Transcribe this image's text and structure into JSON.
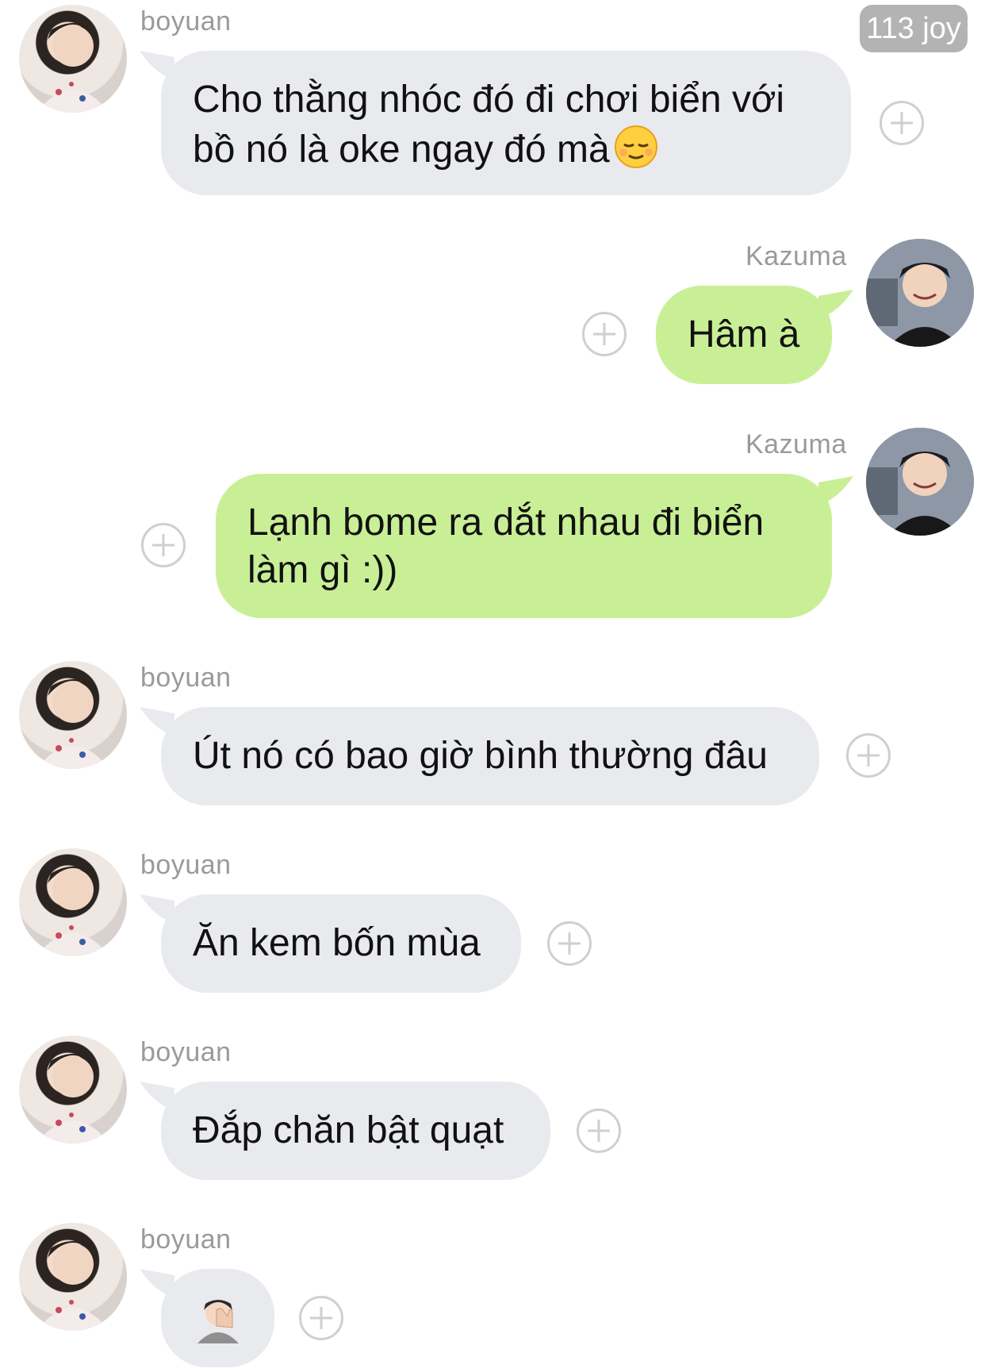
{
  "badge": {
    "text": "113 joy"
  },
  "messages": [
    {
      "sender": "boyuan",
      "text_lines": [
        "Cho thằng nhóc đó đi chơi biển với",
        "bồ nó là oke ngay đó mà"
      ],
      "emoji": "relieved-face"
    },
    {
      "sender": "Kazuma",
      "text": "Hâm à"
    },
    {
      "sender": "Kazuma",
      "text_lines": [
        "Lạnh bome ra dắt nhau đi biển",
        "làm gì :))"
      ]
    },
    {
      "sender": "boyuan",
      "text": "Út nó có bao giờ bình thường đâu"
    },
    {
      "sender": "boyuan",
      "text": "Ăn kem bốn mùa"
    },
    {
      "sender": "boyuan",
      "text": "Đắp chăn bật quạt"
    },
    {
      "sender": "boyuan",
      "emoji": "person-facepalming"
    }
  ],
  "colors": {
    "incoming_bubble": "#e9eaee",
    "outgoing_bubble": "#c9ef96",
    "sender_name": "#9a9a9a",
    "badge": "#b3b3b3",
    "plus_icon": "#cfcfcf"
  },
  "icons": {
    "reaction_add": "plus-circle-icon"
  }
}
